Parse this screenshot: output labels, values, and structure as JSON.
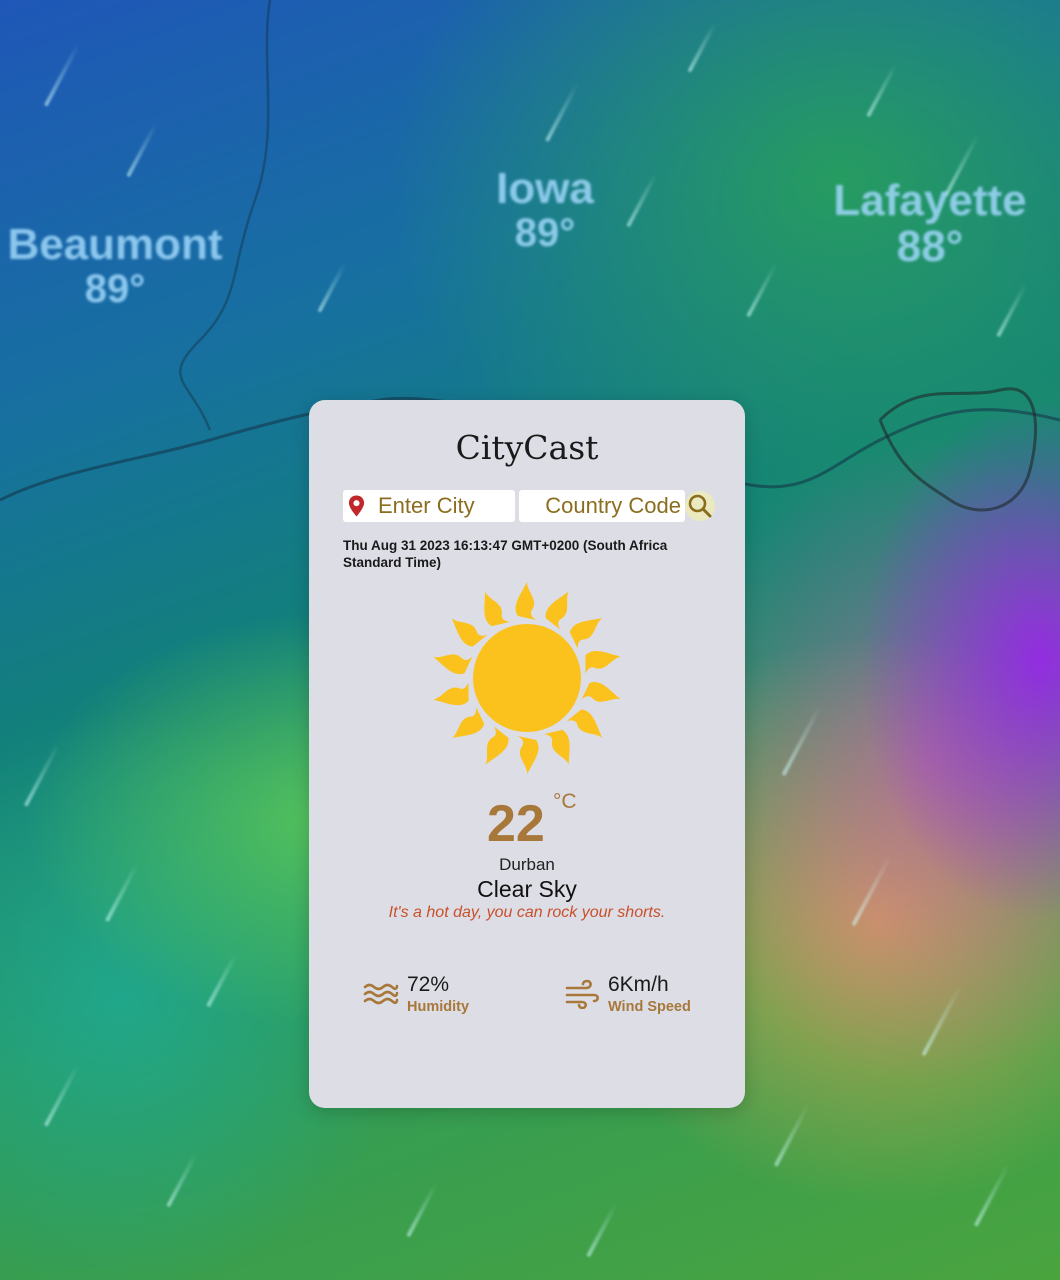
{
  "background": {
    "labels": [
      {
        "name": "Beaumont",
        "temp": "89°"
      },
      {
        "name": "Iowa",
        "temp": "89°"
      },
      {
        "name": "Lafayette",
        "temp": "88°"
      }
    ]
  },
  "app": {
    "title": "CityCast",
    "search": {
      "city_placeholder": "Enter City",
      "country_placeholder": "Country Code",
      "city_value": "",
      "country_value": ""
    },
    "datetime": "Thu Aug 31 2023 16:13:47 GMT+0200 (South Africa Standard Time)",
    "weather": {
      "icon": "sun-icon",
      "temperature": "22",
      "unit": "°C",
      "city": "Durban",
      "condition": "Clear Sky",
      "tip": "It's a hot day, you can rock your shorts."
    },
    "stats": {
      "humidity_value": "72%",
      "humidity_label": "Humidity",
      "wind_value": "6Km/h",
      "wind_label": "Wind Speed"
    }
  },
  "colors": {
    "accent": "#a7783a",
    "input_text": "#8a6e1e",
    "tip_text": "#c9502a",
    "pin": "#c0282a",
    "sun": "#fbc21d",
    "card_bg": "#dddde6"
  }
}
